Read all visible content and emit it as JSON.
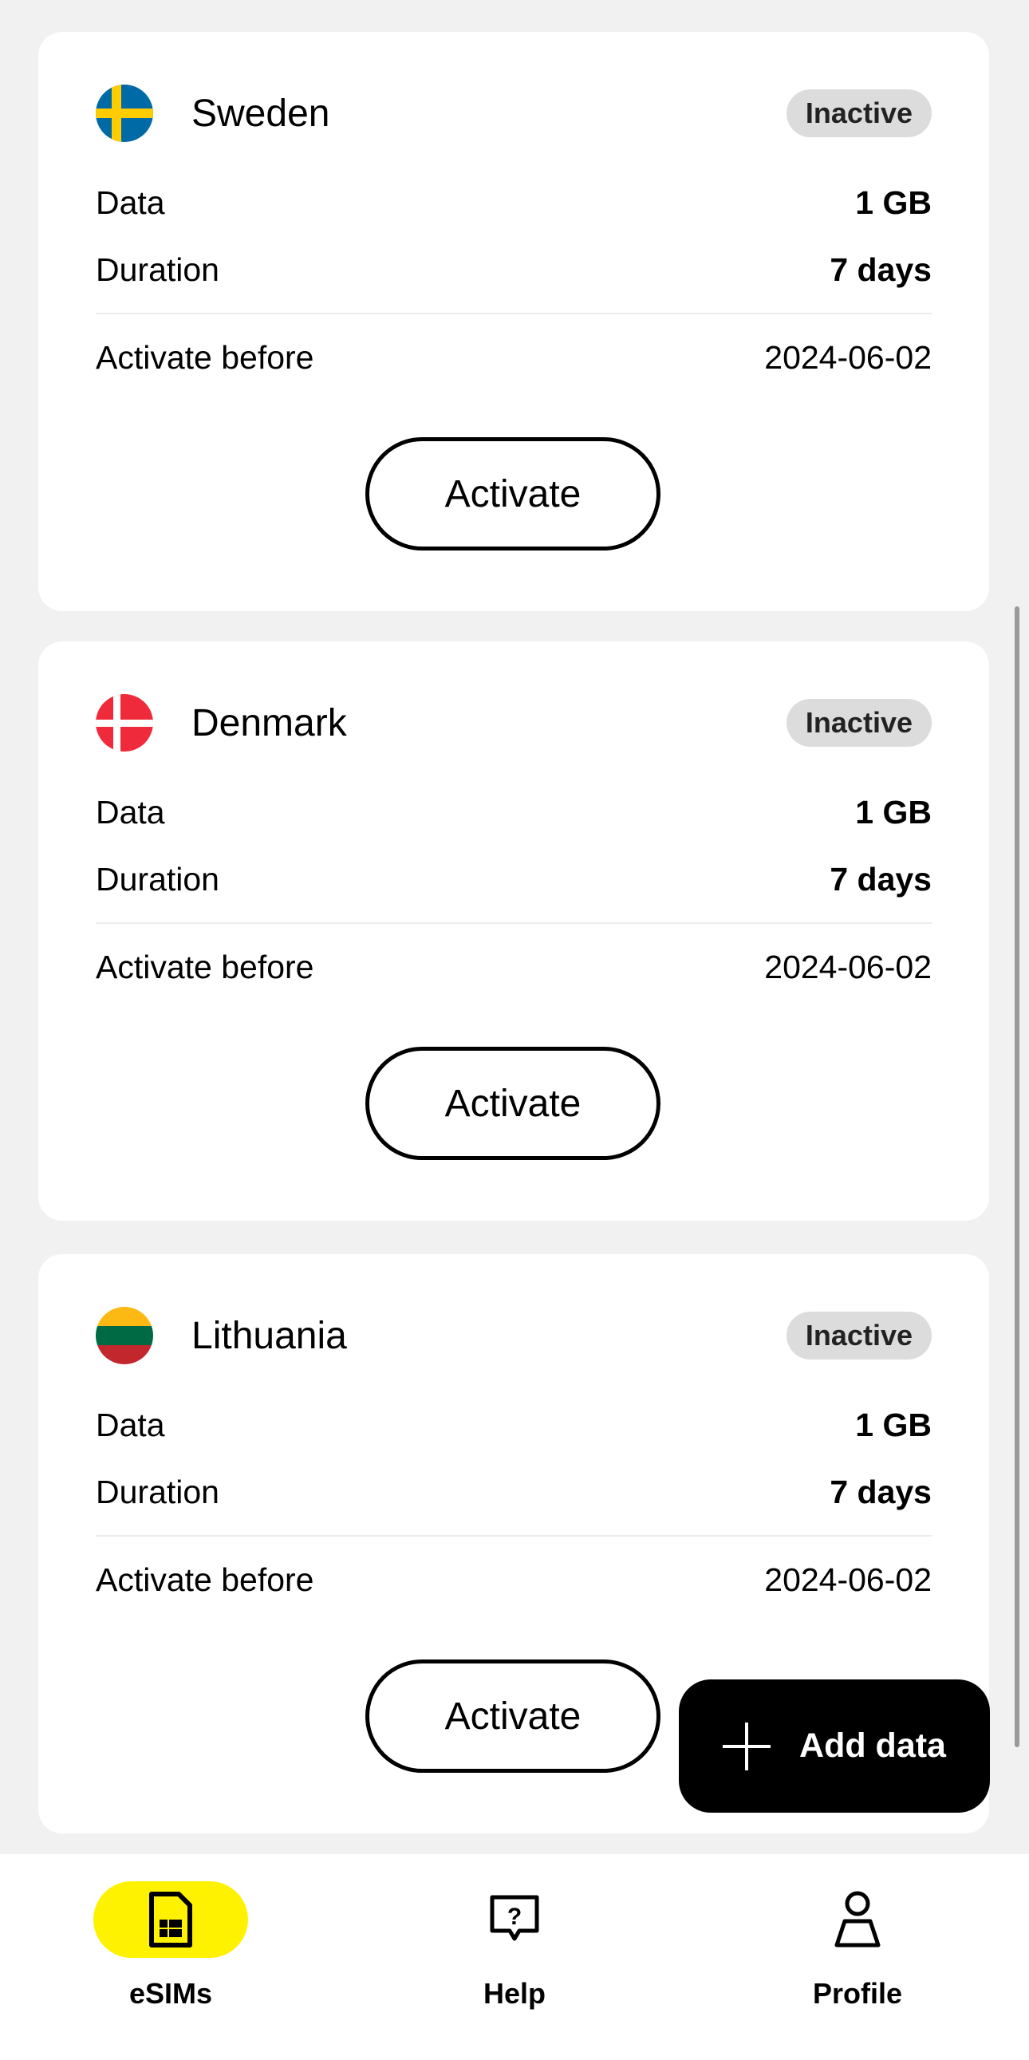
{
  "esims": [
    {
      "country": "Sweden",
      "flag": "sweden-flag",
      "status": "Inactive",
      "data_label": "Data",
      "data_value": "1 GB",
      "duration_label": "Duration",
      "duration_value": "7 days",
      "activate_before_label": "Activate before",
      "activate_before_value": "2024-06-02",
      "button": "Activate"
    },
    {
      "country": "Denmark",
      "flag": "denmark-flag",
      "status": "Inactive",
      "data_label": "Data",
      "data_value": "1 GB",
      "duration_label": "Duration",
      "duration_value": "7 days",
      "activate_before_label": "Activate before",
      "activate_before_value": "2024-06-02",
      "button": "Activate"
    },
    {
      "country": "Lithuania",
      "flag": "lithuania-flag",
      "status": "Inactive",
      "data_label": "Data",
      "data_value": "1 GB",
      "duration_label": "Duration",
      "duration_value": "7 days",
      "activate_before_label": "Activate before",
      "activate_before_value": "2024-06-02",
      "button": "Activate"
    }
  ],
  "fab": {
    "label": "Add data",
    "icon": "plus-icon"
  },
  "tabbar": {
    "tabs": [
      {
        "label": "eSIMs",
        "icon": "sim-card-icon",
        "active": true
      },
      {
        "label": "Help",
        "icon": "help-chat-icon",
        "active": false
      },
      {
        "label": "Profile",
        "icon": "profile-icon",
        "active": false
      }
    ]
  },
  "colors": {
    "background": "#f1f1f1",
    "card": "#ffffff",
    "badge": "#dcdcdc",
    "accent": "#fff200",
    "fab": "#000000"
  }
}
